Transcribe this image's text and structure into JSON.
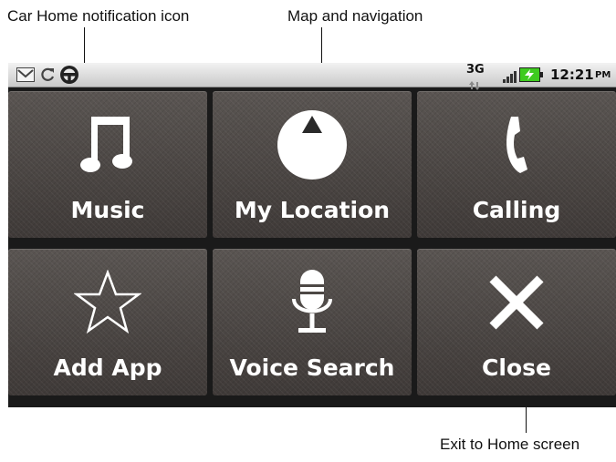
{
  "callouts": {
    "car_home": "Car Home notification icon",
    "map_nav": "Map and navigation",
    "exit_home": "Exit to Home screen"
  },
  "status_bar": {
    "network": "3G",
    "time": "12:21",
    "ampm": "PM",
    "icons": [
      "gmail-icon",
      "sync-icon",
      "car-home-icon",
      "signal-icon",
      "battery-charging-icon"
    ]
  },
  "tiles": [
    {
      "label": "Music",
      "icon": "music-note-icon"
    },
    {
      "label": "My Location",
      "icon": "location-icon"
    },
    {
      "label": "Calling",
      "icon": "phone-icon"
    },
    {
      "label": "Add App",
      "icon": "star-icon"
    },
    {
      "label": "Voice Search",
      "icon": "microphone-icon"
    },
    {
      "label": "Close",
      "icon": "close-icon"
    }
  ],
  "colors": {
    "tile": "#4d4845",
    "battery_green": "#3ecb1f",
    "signal_green": "#35b84a"
  }
}
